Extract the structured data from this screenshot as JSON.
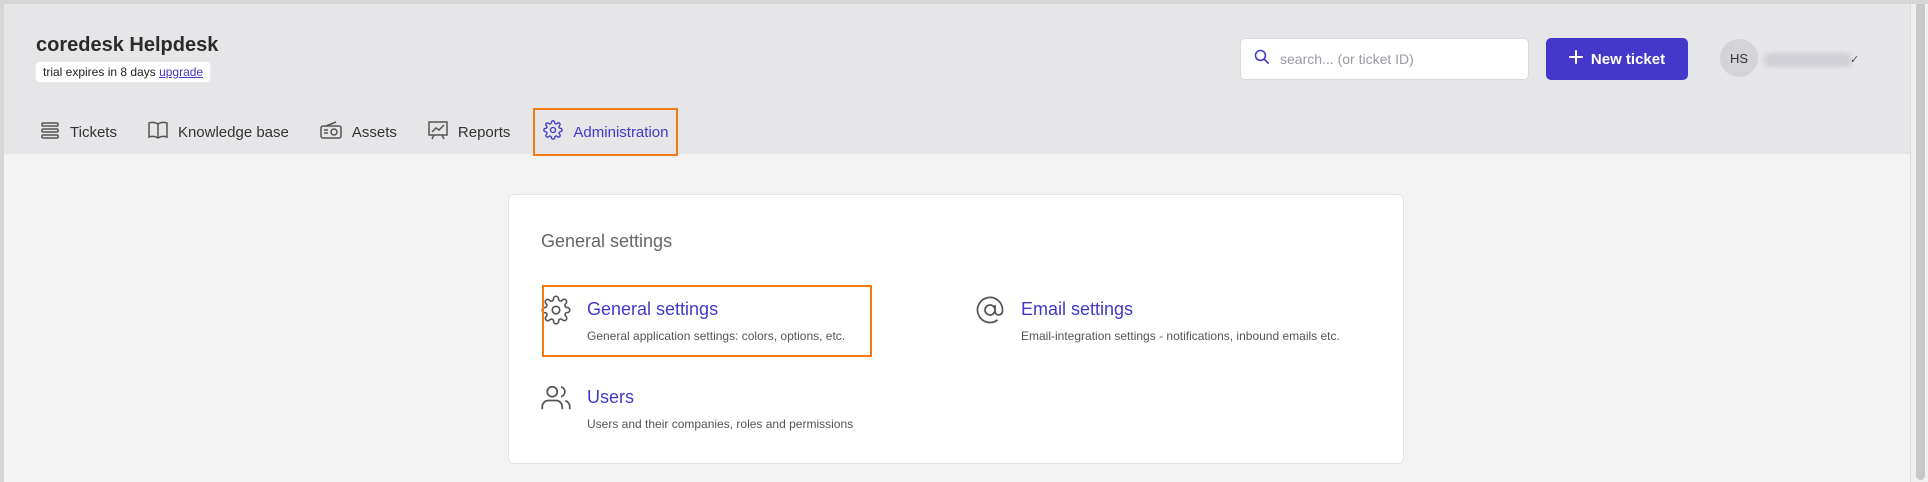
{
  "header": {
    "brand": "coredesk Helpdesk",
    "trial_text": "trial expires in 8 days",
    "trial_link": "upgrade",
    "search_placeholder": "search... (or ticket ID)",
    "new_ticket_label": "New ticket",
    "avatar_initials": "HS",
    "accent_color": "#4338ca"
  },
  "nav": {
    "items": [
      {
        "label": "Tickets",
        "icon": "tickets-icon"
      },
      {
        "label": "Knowledge base",
        "icon": "book-icon"
      },
      {
        "label": "Assets",
        "icon": "radio-icon"
      },
      {
        "label": "Reports",
        "icon": "chart-icon"
      },
      {
        "label": "Administration",
        "icon": "gear-icon",
        "active": true
      }
    ]
  },
  "main": {
    "section_title": "General settings",
    "settings": [
      {
        "name": "General settings",
        "desc": "General application settings: colors, options, etc.",
        "icon": "gear-icon",
        "highlighted": true
      },
      {
        "name": "Email settings",
        "desc": "Email-integration settings - notifications, inbound emails etc.",
        "icon": "at-icon"
      },
      {
        "name": "Users",
        "desc": "Users and their companies, roles and permissions",
        "icon": "users-icon"
      }
    ]
  },
  "highlight_color": "#f57a14"
}
